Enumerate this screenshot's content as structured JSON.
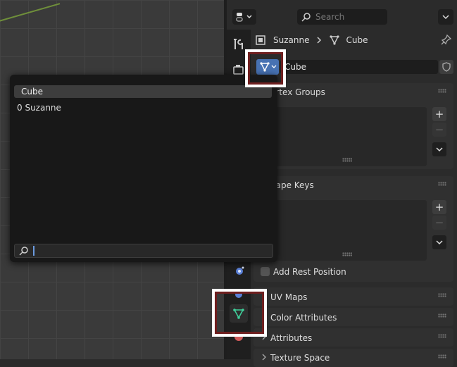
{
  "header": {
    "search_placeholder": "Search"
  },
  "breadcrumb": {
    "object": "Suzanne",
    "data": "Cube"
  },
  "datablock": {
    "name": "Cube"
  },
  "panels": {
    "vertex_groups": "ertex Groups",
    "shape_keys": "hape Keys",
    "add_rest_position": "Add Rest Position",
    "uv_maps": "UV Maps",
    "color_attributes": "Color Attributes",
    "attributes": "Attributes",
    "texture_space": "Texture Space"
  },
  "popup": {
    "items": [
      "Cube",
      "0 Suzanne"
    ]
  },
  "colors": {
    "accent": "#4772b3",
    "mesh_tab_icon": "#3fcf9a",
    "highlight_frame": "#6e1f1f"
  }
}
